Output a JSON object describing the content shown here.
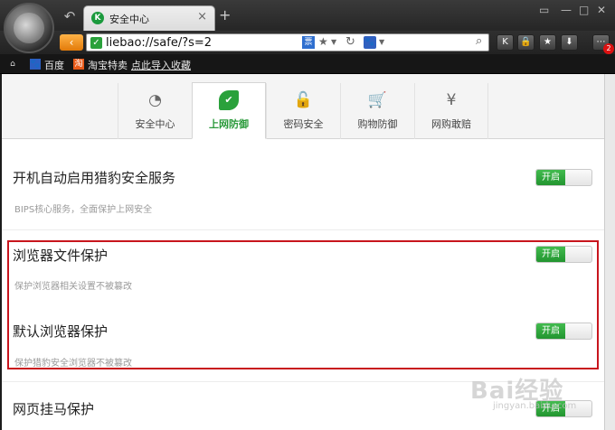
{
  "browser": {
    "tab_title": "安全中心",
    "tab_close": "×",
    "new_tab": "+",
    "back": "↶",
    "url": "liebao://safe/?s=2",
    "nav_arrow": "‹",
    "mode_label": "票",
    "badge_count": "2"
  },
  "bookmarks": [
    {
      "icon": "⌂",
      "label": ""
    },
    {
      "icon": "🐾",
      "label": "百度"
    },
    {
      "icon": "淘",
      "label": "淘宝特卖"
    },
    {
      "icon": "",
      "label": "点此导入收藏"
    }
  ],
  "protection_tabs": [
    {
      "label": "安全中心",
      "icon": "gauge-icon",
      "glyph": "◔"
    },
    {
      "label": "上网防御",
      "icon": "leaf-icon",
      "glyph": "✔"
    },
    {
      "label": "密码安全",
      "icon": "lock-icon",
      "glyph": "🔓"
    },
    {
      "label": "购物防御",
      "icon": "cart-icon",
      "glyph": "🛒"
    },
    {
      "label": "网购敢赔",
      "icon": "money-hand-icon",
      "glyph": "¥"
    }
  ],
  "settings": [
    {
      "title": "开机自动启用猎豹安全服务",
      "desc": "BIPS核心服务，全面保护上网安全",
      "toggle": "开启"
    },
    {
      "title": "浏览器文件保护",
      "desc": "保护浏览器相关设置不被篡改",
      "toggle": "开启"
    },
    {
      "title": "默认浏览器保护",
      "desc": "保护猎豹安全浏览器不被篡改",
      "toggle": "开启"
    },
    {
      "title": "网页挂马保护",
      "desc": "",
      "toggle": "开启"
    }
  ],
  "colors": {
    "accent_green": "#2aa13b",
    "highlight_red": "#c8151d",
    "nav_orange": "#e27a09"
  },
  "watermark": {
    "main": "Bai经验",
    "sub": "jingyan.baidu.com"
  }
}
